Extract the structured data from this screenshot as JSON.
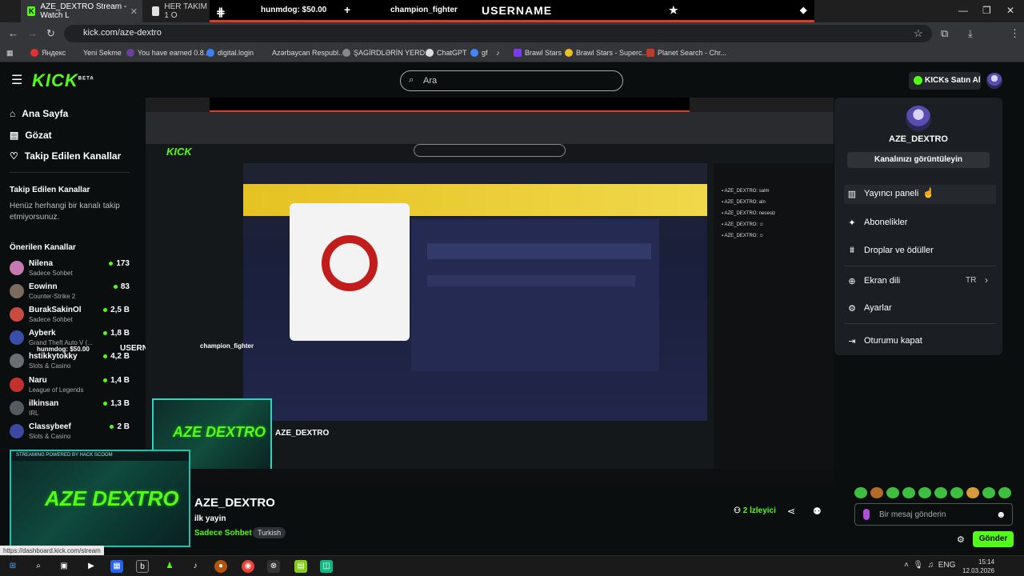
{
  "browser": {
    "tabs": [
      {
        "title": "AZE_DEXTRO Stream - Watch L"
      },
      {
        "title": "HER TAKIM 1 O"
      }
    ],
    "overlay_texts": [
      "hunmdog: $50.00",
      "champion_fighter",
      "USERNAME"
    ],
    "url": "kick.com/aze-dextro",
    "bookmarks": [
      "Яндекс",
      "Yeni Sekme",
      "You have earned 0.8...",
      "digital.login",
      "Azərbaycan Respubl...",
      "ŞAGİRDLƏRİN YERD...",
      "ChatGPT",
      "gf",
      "Brawl Stars",
      "Brawl Stars - Superc...",
      "Planet Search - Chr..."
    ]
  },
  "header": {
    "logo": "KICK",
    "logo_badge": "BETA",
    "search_placeholder": "Ara",
    "kicks_button": "KICKs Satın Al"
  },
  "sidebar": {
    "nav": [
      {
        "label": "Ana Sayfa",
        "icon": "home-icon"
      },
      {
        "label": "Gözat",
        "icon": "browse-icon"
      },
      {
        "label": "Takip Edilen Kanallar",
        "icon": "heart-icon"
      }
    ],
    "followed_heading": "Takip Edilen Kanallar",
    "followed_empty": "Henüz herhangi bir kanalı takip etmiyorsunuz.",
    "recommended_heading": "Önerilen Kanallar",
    "channels": [
      {
        "name": "Nilena",
        "category": "Sadece Sohbet",
        "viewers": "173",
        "color": "#c77ab2"
      },
      {
        "name": "Eowinn",
        "category": "Counter-Strike 2",
        "viewers": "83",
        "color": "#7c6a5e"
      },
      {
        "name": "BurakSakinOl",
        "category": "Sadece Sohbet",
        "viewers": "2,5 B",
        "color": "#c94a3e"
      },
      {
        "name": "Ayberk",
        "category": "Grand Theft Auto V (...",
        "viewers": "1,8 B",
        "color": "#3a4ea8"
      },
      {
        "name": "hstikkytokky",
        "category": "Slots & Casino",
        "viewers": "4,2 B",
        "color": "#6b6f74"
      },
      {
        "name": "Naru",
        "category": "League of Legends",
        "viewers": "1,4 B",
        "color": "#c23030"
      },
      {
        "name": "ilkinsan",
        "category": "IRL",
        "viewers": "1,3 B",
        "color": "#555a60"
      },
      {
        "name": "Classybeef",
        "category": "Slots & Casino",
        "viewers": "2 B",
        "color": "#3b4aa0"
      }
    ]
  },
  "player": {
    "webcam_text": "AZE DEXTRO",
    "webcam_caption": "STREAMING POWERED BY HACK SCOOM",
    "floating_overlay": [
      "hunmdog: $50.00",
      "USERNAME",
      "champion_fighter"
    ]
  },
  "stream": {
    "title": "AZE_DEXTRO",
    "subtitle": "ilk yayin",
    "category": "Sadece Sohbet",
    "tag": "Turkish",
    "viewers_count": "2",
    "viewers_label": "İzleyici"
  },
  "chat": {
    "input_placeholder": "Bir mesaj gönderin",
    "send_label": "Gönder"
  },
  "dropdown": {
    "username": "AZE_DEXTRO",
    "channel_button": "Kanalınızı görüntüleyin",
    "items": [
      {
        "label": "Yayıncı paneli",
        "icon": "dashboard-icon"
      },
      {
        "label": "Abonelikler",
        "icon": "sparkle-icon"
      },
      {
        "label": "Droplar ve ödüller",
        "icon": "drops-icon"
      },
      {
        "label": "Ekran dili",
        "icon": "globe-icon",
        "value": "TR"
      },
      {
        "label": "Ayarlar",
        "icon": "gear-icon"
      },
      {
        "label": "Oturumu kapat",
        "icon": "logout-icon"
      }
    ]
  },
  "status_url": "https://dashboard.kick.com/stream",
  "taskbar": {
    "language": "ENG",
    "time": "15:14",
    "date": "12.03.2026"
  },
  "colors": {
    "kick_green": "#53fc18",
    "background": "#0b0e0f",
    "panel": "#1b1e22"
  }
}
